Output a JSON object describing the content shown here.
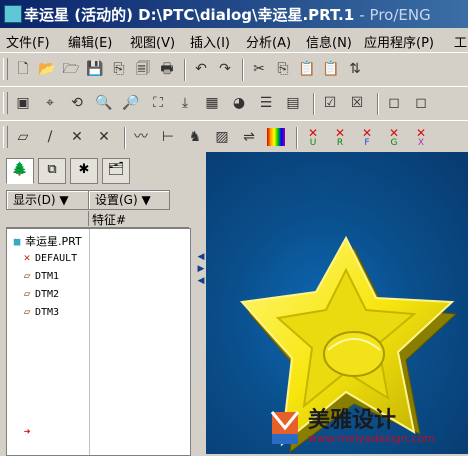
{
  "window": {
    "title_main": "幸运星 (活动的)",
    "title_path": "D:\\PTC\\dialog\\幸运星.PRT.1",
    "title_app": "- Pro/ENG"
  },
  "menu": [
    {
      "label": "文件(F)"
    },
    {
      "label": "编辑(E)"
    },
    {
      "label": "视图(V)"
    },
    {
      "label": "插入(I)"
    },
    {
      "label": "分析(A)"
    },
    {
      "label": "信息(N)"
    },
    {
      "label": "应用程序(P)"
    },
    {
      "label": "工"
    }
  ],
  "toolbar1": [
    {
      "name": "new-file-icon",
      "glyph": "🗋"
    },
    {
      "name": "open-folder-icon",
      "glyph": "📂"
    },
    {
      "name": "open-session-icon",
      "glyph": "🗁"
    },
    {
      "name": "save-icon",
      "glyph": "💾"
    },
    {
      "name": "save-copy-icon",
      "glyph": "⎘"
    },
    {
      "name": "backup-icon",
      "glyph": "🗐"
    },
    {
      "name": "print-icon",
      "glyph": "🖶"
    },
    {
      "name": "undo-icon",
      "glyph": "↶"
    },
    {
      "name": "redo-icon",
      "glyph": "↷"
    },
    {
      "name": "cut-icon",
      "glyph": "✂"
    },
    {
      "name": "copy-icon",
      "glyph": "⎘"
    },
    {
      "name": "paste-icon",
      "glyph": "📋"
    },
    {
      "name": "paste-special-icon",
      "glyph": "📋"
    },
    {
      "name": "regenerate-icon",
      "glyph": "⇅"
    }
  ],
  "toolbar2": [
    {
      "name": "repaint-icon",
      "glyph": "▣"
    },
    {
      "name": "spin-center-icon",
      "glyph": "⌖"
    },
    {
      "name": "orient-mode-icon",
      "glyph": "⟲"
    },
    {
      "name": "zoom-in-icon",
      "glyph": "🔍"
    },
    {
      "name": "zoom-out-icon",
      "glyph": "🔎"
    },
    {
      "name": "refit-icon",
      "glyph": "⛶"
    },
    {
      "name": "reorient-icon",
      "glyph": "⤓"
    },
    {
      "name": "saved-views-icon",
      "glyph": "▦"
    },
    {
      "name": "appearance-icon",
      "glyph": "◕"
    },
    {
      "name": "layers-icon",
      "glyph": "☰"
    },
    {
      "name": "view-manager-icon",
      "glyph": "▤"
    },
    {
      "name": "confirm-icon",
      "glyph": "☑"
    },
    {
      "name": "cancel-icon",
      "glyph": "☒"
    },
    {
      "name": "wireframe-icon",
      "glyph": "◻"
    },
    {
      "name": "hidden-line-icon",
      "glyph": "◻"
    }
  ],
  "toolbar3": [
    {
      "name": "datum-planes-icon",
      "glyph": "▱"
    },
    {
      "name": "datum-axes-icon",
      "glyph": "/"
    },
    {
      "name": "datum-points-icon",
      "glyph": "✕"
    },
    {
      "name": "coordinate-systems-icon",
      "glyph": "✕"
    },
    {
      "name": "sketch-curve-icon",
      "glyph": "〰"
    },
    {
      "name": "measure-icon",
      "glyph": "⊢"
    },
    {
      "name": "model-analysis-icon",
      "glyph": "♞"
    },
    {
      "name": "curvature-icon",
      "glyph": "▨"
    },
    {
      "name": "reflection-icon",
      "glyph": "⇌"
    },
    {
      "name": "color-map-icon",
      "glyph": "▮"
    },
    {
      "name": "undo-analysis-icon",
      "glyph": "✕"
    },
    {
      "name": "rename-analysis-icon",
      "glyph": "✕"
    },
    {
      "name": "feature-analysis-icon",
      "glyph": "✕"
    },
    {
      "name": "geometry-analysis-icon",
      "glyph": "✕"
    },
    {
      "name": "delete-analysis-icon",
      "glyph": "✕"
    }
  ],
  "toolbar3_letters": [
    "U",
    "R",
    "F",
    "G",
    "X"
  ],
  "panel": {
    "tabs": [
      {
        "name": "model-tree-tab",
        "glyph": "🌲"
      },
      {
        "name": "layer-tab",
        "glyph": "⧉"
      },
      {
        "name": "favorites-tab",
        "glyph": "✱"
      },
      {
        "name": "connections-tab",
        "glyph": "🗂"
      }
    ],
    "show_button": "显示(D) ▼",
    "settings_button": "设置(G) ▼",
    "column_header": "特征#"
  },
  "tree": [
    {
      "label": "幸运星.PRT",
      "icon": "part-icon",
      "glyph": "■",
      "indent": 0
    },
    {
      "label": "DEFAULT",
      "icon": "coordinate-system-icon",
      "glyph": "✕",
      "indent": 1
    },
    {
      "label": "DTM1",
      "icon": "datum-plane-icon",
      "glyph": "▱",
      "indent": 1
    },
    {
      "label": "DTM2",
      "icon": "datum-plane-icon",
      "glyph": "▱",
      "indent": 1
    },
    {
      "label": "DTM3",
      "icon": "datum-plane-icon",
      "glyph": "▱",
      "indent": 1
    },
    {
      "label": "",
      "icon": "insert-here-arrow-icon",
      "glyph": "➜",
      "indent": 1
    }
  ],
  "watermark": {
    "brand": "美雅设计",
    "url": "www.meiyadesign.com"
  },
  "colors": {
    "star": "#f7e60f",
    "star_edge": "#b4a600",
    "viewport": "#0a4f8c",
    "title_start": "#0a246a"
  }
}
